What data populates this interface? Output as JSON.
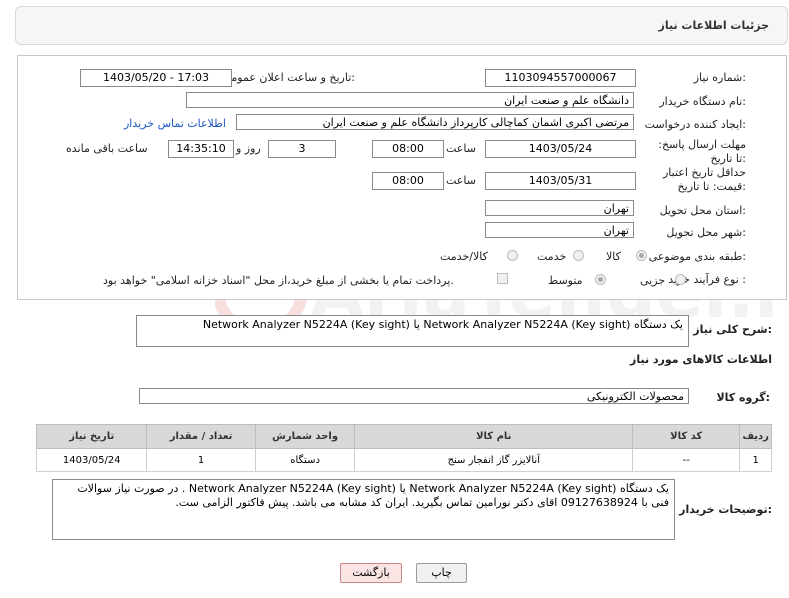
{
  "header": {
    "title": "جزئیات اطلاعات نیاز"
  },
  "form": {
    "need_number": {
      "label": "شماره نیاز:",
      "value": "1103094557000067"
    },
    "announce_datetime": {
      "label": "تاریخ و ساعت اعلان عمومی:",
      "value": "1403/05/20 - 17:03"
    },
    "buyer_org": {
      "label": "نام دستگاه خریدار:",
      "value": "دانشگاه علم و صنعت ایران"
    },
    "requester": {
      "label": "ایجاد کننده درخواست:",
      "value": "مرتضی اکبری اشمان کماچالی کارپرداز دانشگاه علم و صنعت ایران",
      "contact_link": "اطلاعات تماس خریدار"
    },
    "reply_deadline": {
      "label": "مهلت ارسال پاسخ: تا تاریخ:",
      "date": "1403/05/24",
      "time_label": "ساعت",
      "time": "08:00",
      "days": "3",
      "days_label": "روز و",
      "remaining": "14:35:10",
      "remaining_label": "ساعت باقی مانده"
    },
    "price_validity": {
      "label": "حداقل تاریخ اعتبار قیمت: تا تاریخ:",
      "date": "1403/05/31",
      "time_label": "ساعت",
      "time": "08:00"
    },
    "province": {
      "label": "استان محل تحویل:",
      "value": "تهران"
    },
    "city": {
      "label": "شهر محل تحویل:",
      "value": "تهران"
    },
    "category": {
      "label": "طبقه بندی موضوعی:",
      "options": [
        "کالا",
        "خدمت",
        "کالا/خدمت"
      ]
    },
    "process_type": {
      "label": "نوع فرآیند خرید :",
      "options": [
        "جزیی",
        "متوسط"
      ],
      "payment_note": "پرداخت تمام یا بخشی از مبلغ خرید،از محل \"اسناد خزانه اسلامی\" خواهد بود."
    }
  },
  "description": {
    "label": "شرح کلی نیاز:",
    "value": "یک دستگاه Network Analyzer N5224A (Key sight)  یا  Network Analyzer N5224A (Key sight)"
  },
  "goods_section": {
    "title": "اطلاعات کالاهای مورد نیاز",
    "group_label": "گروه کالا:",
    "group_value": "محصولات الکترونیکی"
  },
  "goods_table": {
    "headers": [
      "ردیف",
      "کد کالا",
      "نام کالا",
      "واحد شمارش",
      "تعداد / مقدار",
      "تاریخ نیاز"
    ],
    "rows": [
      [
        "1",
        "--",
        "آنالایزر گاز انفجار سنج",
        "دستگاه",
        "1",
        "1403/05/24"
      ]
    ]
  },
  "buyer_notes": {
    "label": "توضیحات خریدار:",
    "line1": "یک دستگاه Network Analyzer N5224A (Key sight)  یا  Network Analyzer N5224A (Key sight) . در صورت نیاز سوالات",
    "line2": "فنی با 09127638924 اقای دکتر نورامین تماس بگیرید. ایران کد مشابه می باشد. پیش فاکتور الزامی ست."
  },
  "buttons": {
    "print": "چاپ",
    "back": "بازگشت"
  },
  "watermark_text": "AriaTender.neT",
  "colors": {
    "link": "#1a55c4",
    "header_bg": "#f6f6f6",
    "table_header_bg": "#d8d8d8",
    "back_button_bg": "#fbe4e4"
  }
}
